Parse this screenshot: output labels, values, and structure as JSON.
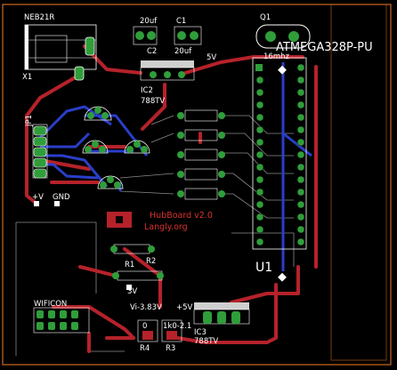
{
  "board": {
    "title": "HubBoard v2.0",
    "subtitle": "Langly.org"
  },
  "labels": {
    "neb21r": "NEB21R",
    "x1": "X1",
    "c2_value": "20uf",
    "c1": "C1",
    "c2": "C2",
    "c1_value": "20uf",
    "q1": "Q1",
    "mcu": "ATMEGA328P-PU",
    "crystal": "16mhz",
    "five_v_top": "5V",
    "ic2": "IC2",
    "ic2_part": "788TV",
    "jp1": "JP1",
    "u1": "U1",
    "plus_v": "+V",
    "gnd": "GND",
    "r1": "R1",
    "r2": "R2",
    "three_v": "3V",
    "wificon": "WIFICON",
    "vi_label": "Vi-3.83V",
    "plus5v": "+5V",
    "r4_value": "0",
    "r3_value": "1k0-2.1",
    "r4": "R4",
    "r3": "R3",
    "ic3": "IC3",
    "ic3_part": "788TV"
  },
  "colors": {
    "background": "#000000",
    "trace_red": "#b5222a",
    "trace_blue": "#2a3ec9",
    "pad_green": "#2f9e3a",
    "outline": "#d0691e",
    "silk": "#ffffff"
  }
}
